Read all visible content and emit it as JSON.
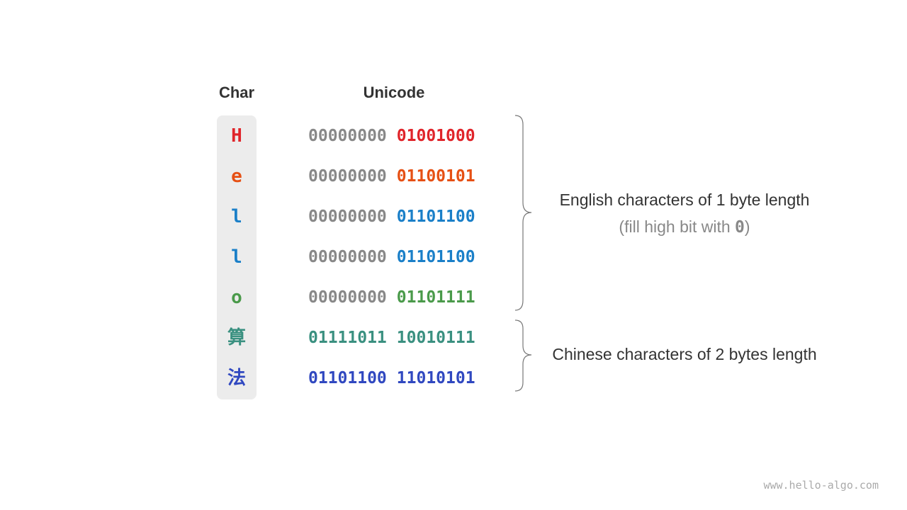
{
  "headers": {
    "char": "Char",
    "unicode": "Unicode"
  },
  "rows": [
    {
      "char": "H",
      "high": "00000000",
      "low": "01001000",
      "char_color": "#e0242a",
      "high_color": "#888888",
      "low_color": "#e0242a"
    },
    {
      "char": "e",
      "high": "00000000",
      "low": "01100101",
      "char_color": "#e65014",
      "high_color": "#888888",
      "low_color": "#e65014"
    },
    {
      "char": "l",
      "high": "00000000",
      "low": "01101100",
      "char_color": "#1a7fc8",
      "high_color": "#888888",
      "low_color": "#1a7fc8"
    },
    {
      "char": "l",
      "high": "00000000",
      "low": "01101100",
      "char_color": "#1a7fc8",
      "high_color": "#888888",
      "low_color": "#1a7fc8"
    },
    {
      "char": "o",
      "high": "00000000",
      "low": "01101111",
      "char_color": "#4a9a4a",
      "high_color": "#888888",
      "low_color": "#4a9a4a"
    },
    {
      "char": "算",
      "high": "01111011",
      "low": "10010111",
      "char_color": "#3a9080",
      "high_color": "#3a9080",
      "low_color": "#3a9080"
    },
    {
      "char": "法",
      "high": "01101100",
      "low": "11010101",
      "char_color": "#3048c0",
      "high_color": "#3048c0",
      "low_color": "#3048c0"
    }
  ],
  "notes": {
    "english": "English characters of 1 byte length",
    "english_sub_prefix": "(fill high bit with ",
    "english_sub_zero": "0",
    "english_sub_suffix": ")",
    "chinese": "Chinese characters of 2 bytes length"
  },
  "watermark": "www.hello-algo.com"
}
